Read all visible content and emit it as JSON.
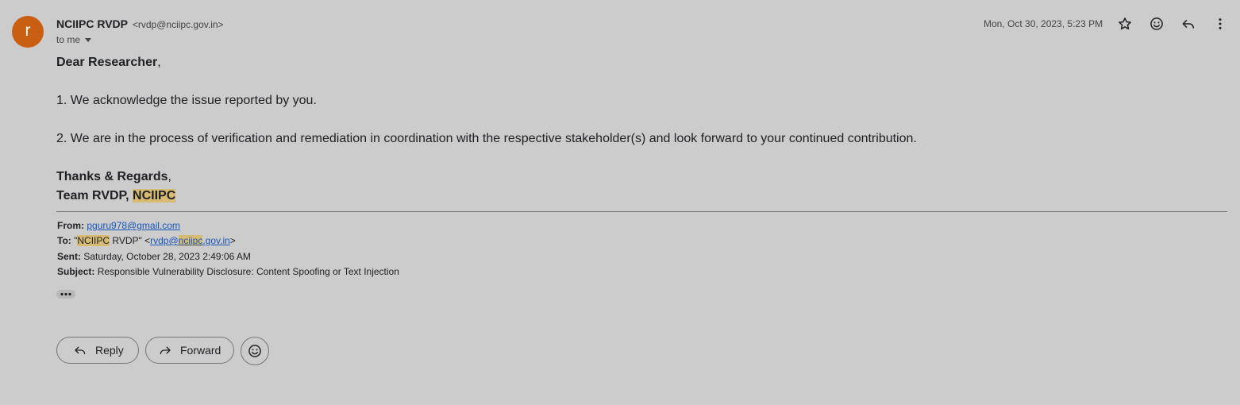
{
  "sender": {
    "avatar_letter": "r",
    "avatar_color": "#c95f12",
    "name": "NCIIPC RVDP",
    "email": "<rvdp@nciipc.gov.in>",
    "recipient_label": "to me",
    "date": "Mon, Oct 30, 2023, 5:23 PM"
  },
  "header_icons": [
    "star-icon",
    "emoji-icon",
    "reply-icon",
    "more-vert-icon"
  ],
  "message": {
    "greeting_bold": "Dear Researcher",
    "greeting_punct": ",",
    "line1": "1. We acknowledge the issue reported by you.",
    "line2": "2. We are in the process of verification and remediation in coordination with the respective stakeholder(s) and look forward to your continued contribution.",
    "closing_bold": "Thanks & Regards",
    "closing_punct": ",",
    "signature_prefix": "Team RVDP, ",
    "signature_org": "NCIIPC"
  },
  "quoted": {
    "from_label": "From:",
    "from_value": "pguru978@gmail.com",
    "to_label": "To:",
    "to_quote_open": "\"",
    "to_name_hl": "NCIIPC",
    "to_name_rest": " RVDP\" <",
    "to_email_part1": "rvdp@",
    "to_email_hl": "nciipc",
    "to_email_part2": ".gov.in",
    "to_close": ">",
    "sent_label": "Sent:",
    "sent_value": "Saturday, October 28, 2023 2:49:06 AM",
    "subject_label": "Subject:",
    "subject_value": "Responsible Vulnerability Disclosure: Content Spoofing or Text Injection"
  },
  "actions": {
    "reply_label": "Reply",
    "forward_label": "Forward"
  },
  "colors": {
    "background": "#cccccc",
    "highlight": "#d8bb73",
    "link": "#1a56b8"
  }
}
